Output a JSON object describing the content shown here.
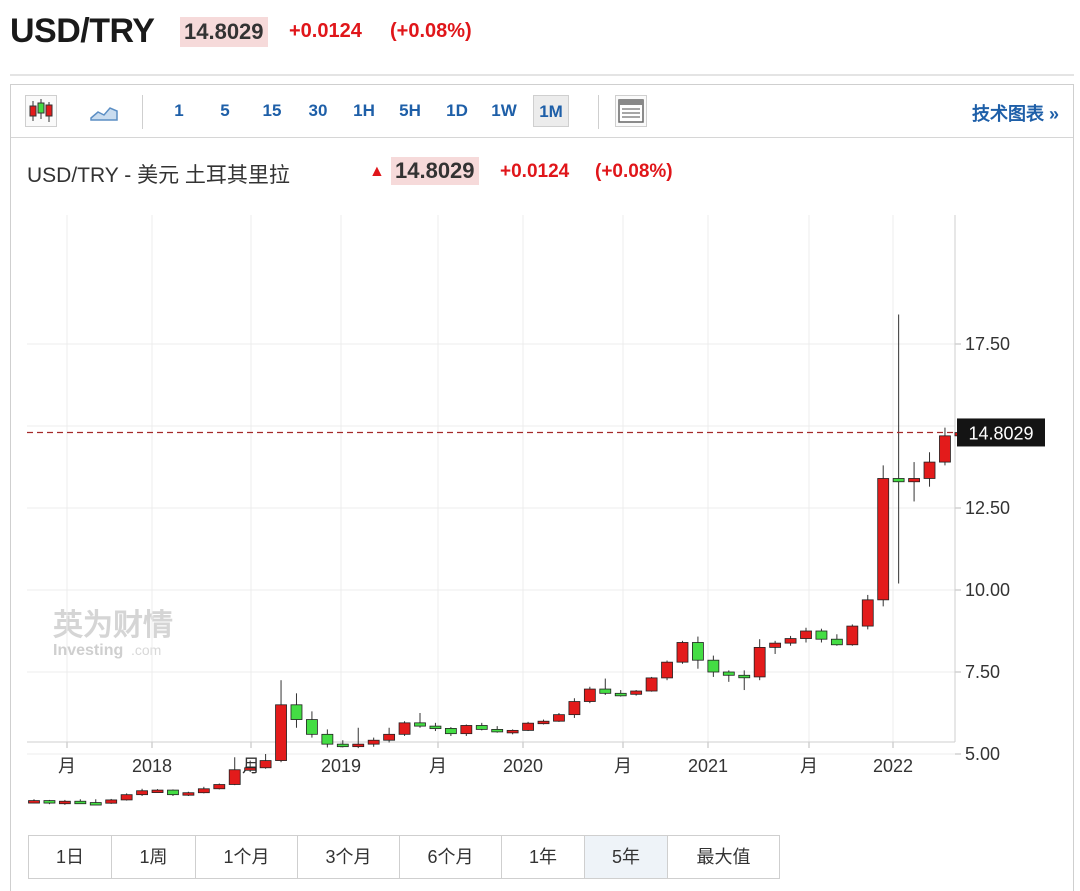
{
  "header": {
    "symbol": "USD/TRY",
    "price": "14.8029",
    "change": "+0.0124",
    "change_pct": "(+0.08%)"
  },
  "toolbar": {
    "chart_type_icons": [
      "candlestick-icon",
      "area-chart-icon"
    ],
    "timeframes": [
      "1",
      "5",
      "15",
      "30",
      "1H",
      "5H",
      "1D",
      "1W",
      "1M"
    ],
    "active_timeframe": "1M",
    "table_icon": "table-icon",
    "advanced_link": "技术图表 »"
  },
  "chart_title": {
    "name": "USD/TRY - 美元 土耳其里拉",
    "arrow": "▲",
    "price": "14.8029",
    "change": "+0.0124",
    "change_pct": "(+0.08%)"
  },
  "watermark": {
    "logo_cn": "英为财情",
    "logo_en": "Investing",
    "logo_dom": ".com"
  },
  "ranges": {
    "buttons": [
      "1日",
      "1周",
      "1个月",
      "3个月",
      "6个月",
      "1年",
      "5年",
      "最大值"
    ],
    "active": "5年"
  },
  "colors": {
    "up": "#e31b1b",
    "down": "#44dd44",
    "accent": "#1e5fa8",
    "last_price_line": "#a52a2a"
  },
  "chart_data": {
    "type": "candlestick",
    "interval": "1M",
    "ylim": [
      3.2,
      18.8
    ],
    "y_ticks": [
      5.0,
      7.5,
      10.0,
      12.5,
      17.5
    ],
    "y_tick_labels": [
      "5.00",
      "7.50",
      "10.00",
      "12.50",
      "17.50"
    ],
    "x_labels": [
      "月",
      "2018",
      "月",
      "2019",
      "月",
      "2020",
      "月",
      "2021",
      "月",
      "2022"
    ],
    "last_price": 14.8029,
    "last_price_label": "14.8029",
    "grid": true,
    "candles": [
      [
        3.53,
        3.62,
        3.5,
        3.58
      ],
      [
        3.58,
        3.6,
        3.47,
        3.52
      ],
      [
        3.52,
        3.6,
        3.45,
        3.56
      ],
      [
        3.56,
        3.62,
        3.48,
        3.52
      ],
      [
        3.52,
        3.62,
        3.48,
        3.5
      ],
      [
        3.5,
        3.63,
        3.48,
        3.6
      ],
      [
        3.6,
        3.8,
        3.58,
        3.76
      ],
      [
        3.76,
        3.94,
        3.72,
        3.88
      ],
      [
        3.88,
        3.93,
        3.82,
        3.9
      ],
      [
        3.9,
        3.92,
        3.72,
        3.76
      ],
      [
        3.76,
        3.85,
        3.72,
        3.82
      ],
      [
        3.82,
        4.0,
        3.8,
        3.94
      ],
      [
        3.94,
        4.1,
        3.92,
        4.07
      ],
      [
        4.07,
        4.9,
        4.05,
        4.52
      ],
      [
        4.52,
        4.8,
        4.45,
        4.58
      ],
      [
        4.58,
        5.0,
        4.55,
        4.8
      ],
      [
        4.8,
        7.25,
        4.75,
        6.5
      ],
      [
        6.5,
        6.85,
        5.8,
        6.05
      ],
      [
        6.05,
        6.3,
        5.5,
        5.6
      ],
      [
        5.6,
        5.75,
        5.2,
        5.3
      ],
      [
        5.3,
        5.42,
        5.2,
        5.25
      ],
      [
        5.25,
        5.8,
        5.18,
        5.3
      ],
      [
        5.3,
        5.5,
        5.22,
        5.42
      ],
      [
        5.42,
        5.8,
        5.35,
        5.6
      ],
      [
        5.6,
        6.0,
        5.55,
        5.95
      ],
      [
        5.95,
        6.25,
        5.8,
        5.85
      ],
      [
        5.85,
        5.95,
        5.7,
        5.78
      ],
      [
        5.78,
        5.82,
        5.55,
        5.62
      ],
      [
        5.62,
        5.9,
        5.55,
        5.87
      ],
      [
        5.87,
        5.95,
        5.72,
        5.75
      ],
      [
        5.75,
        5.85,
        5.65,
        5.68
      ],
      [
        5.68,
        5.75,
        5.6,
        5.72
      ],
      [
        5.72,
        5.98,
        5.7,
        5.94
      ],
      [
        5.94,
        6.05,
        5.9,
        6.0
      ],
      [
        6.0,
        6.25,
        5.98,
        6.2
      ],
      [
        6.2,
        6.7,
        6.1,
        6.6
      ],
      [
        6.6,
        7.05,
        6.55,
        6.98
      ],
      [
        6.98,
        7.3,
        6.8,
        6.85
      ],
      [
        6.85,
        6.95,
        6.75,
        6.82
      ],
      [
        6.82,
        6.95,
        6.78,
        6.92
      ],
      [
        6.92,
        7.35,
        6.9,
        7.32
      ],
      [
        7.32,
        7.85,
        7.25,
        7.8
      ],
      [
        7.8,
        8.45,
        7.75,
        8.4
      ],
      [
        8.4,
        8.58,
        7.6,
        7.86
      ],
      [
        7.86,
        8.0,
        7.35,
        7.5
      ],
      [
        7.5,
        7.55,
        7.2,
        7.4
      ],
      [
        7.4,
        7.55,
        6.95,
        7.35
      ],
      [
        7.35,
        8.5,
        7.25,
        8.25
      ],
      [
        8.25,
        8.45,
        8.05,
        8.38
      ],
      [
        8.38,
        8.6,
        8.3,
        8.52
      ],
      [
        8.52,
        8.85,
        8.4,
        8.75
      ],
      [
        8.75,
        8.82,
        8.4,
        8.5
      ],
      [
        8.5,
        8.65,
        8.3,
        8.33
      ],
      [
        8.33,
        8.95,
        8.3,
        8.9
      ],
      [
        8.9,
        9.85,
        8.8,
        9.7
      ],
      [
        9.7,
        13.8,
        9.5,
        13.4
      ],
      [
        13.4,
        18.4,
        10.2,
        13.3
      ],
      [
        13.3,
        13.9,
        12.7,
        13.4
      ],
      [
        13.4,
        14.2,
        13.15,
        13.9
      ],
      [
        13.9,
        14.95,
        13.8,
        14.7
      ],
      [
        14.7,
        14.95,
        14.6,
        14.8
      ]
    ]
  }
}
